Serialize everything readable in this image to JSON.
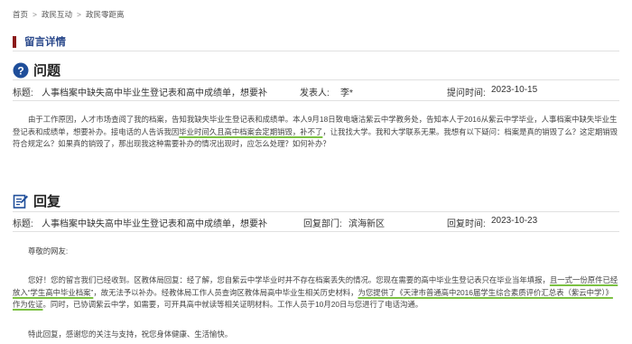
{
  "breadcrumb": [
    "首页",
    "政民互动",
    "政民零距离"
  ],
  "breadcrumb_sep": ">",
  "section_title": "留言详情",
  "question": {
    "heading": "问题",
    "subject_label": "标题:",
    "subject": "人事档案中缺失高中毕业生登记表和高中成绩单，想要补",
    "sender_label": "发表人:",
    "sender": "李*",
    "date_label": "提问时间:",
    "date": "2023-10-15",
    "body_parts": [
      "由于工作原因，人才市场查阅了我的档案，告知我缺失毕业生登记表和成绩单。本人9月18日致电塘沽紫云中学教务处，告知本人于2016从紫云中学毕业，人事档案中缺失毕业生登记表和成绩单，想要补办。接电话的人告诉我因",
      "毕业时间久且高中档案会定期销毁，补不了",
      "，让我找大学。我和大学联系无果。我想有以下疑问：档案是真的销毁了么？这定期销毁符合规定么？如果真的销毁了，那出现我这种需要补办的情况出现时，应怎么处理？如何补办？"
    ]
  },
  "answer": {
    "heading": "回复",
    "subject_label": "标题:",
    "subject": "人事档案中缺失高中毕业生登记表和高中成绩单，想要补",
    "dept_label": "回复部门:",
    "dept": "滨海新区",
    "date_label": "回复时间:",
    "date": "2023-10-23",
    "greeting": "尊敬的网友:",
    "body_parts": [
      "您好！您的留言我们已经收到。区教体局回复：经了解，您自紫云中学毕业时并不存在档案丢失的情况。您现在需要的高中毕业生登记表只在毕业当年填报，",
      "且一式一份原件已经放入“学生高中毕业档案”",
      "，故无法予以补办。经教体局工作人员查询区教体局高中毕业生相关历史材料，",
      "为您提供了《天津市普通高中2016届学生综合素质评价汇总表（紫云中学）》作为佐证",
      "。同时，已协调紫云中学，如需要，可开具高中就读等相关证明材料",
      "。工作人员于10月20日与您进行了电话沟通。"
    ],
    "closing": "特此回复，感谢您的关注与支持，祝您身体健康、生活愉快。"
  },
  "colors": {
    "accent_bar": "#8b1a1a",
    "section_title": "#2c4a8c",
    "question_icon": "#1f4e9a",
    "underline": "#7cc143"
  }
}
